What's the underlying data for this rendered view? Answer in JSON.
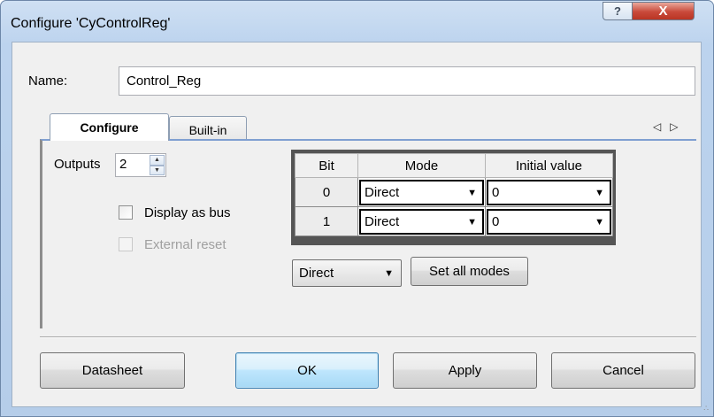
{
  "window": {
    "title": "Configure 'CyControlReg'",
    "help_glyph": "?",
    "close_glyph": "X"
  },
  "name": {
    "label": "Name:",
    "value": "Control_Reg"
  },
  "tabs": [
    {
      "label": "Configure",
      "active": true
    },
    {
      "label": "Built-in",
      "active": false
    }
  ],
  "tab_scroll": {
    "left": "◁",
    "right": "▷"
  },
  "configure": {
    "outputs_label": "Outputs",
    "outputs_value": "2",
    "display_as_bus": {
      "label": "Display as bus",
      "checked": false,
      "enabled": true
    },
    "external_reset": {
      "label": "External reset",
      "checked": false,
      "enabled": false
    },
    "grid": {
      "headers": [
        "Bit",
        "Mode",
        "Initial value"
      ],
      "rows": [
        {
          "bit": "0",
          "mode": "Direct",
          "initial": "0"
        },
        {
          "bit": "1",
          "mode": "Direct",
          "initial": "0"
        }
      ]
    },
    "all_mode_value": "Direct",
    "set_all_modes_label": "Set all modes"
  },
  "footer": {
    "datasheet": "Datasheet",
    "ok": "OK",
    "apply": "Apply",
    "cancel": "Cancel"
  },
  "colors": {
    "title_bar": "#bcd3ee",
    "close_button": "#c9493a",
    "default_button": "#bee6fd"
  }
}
